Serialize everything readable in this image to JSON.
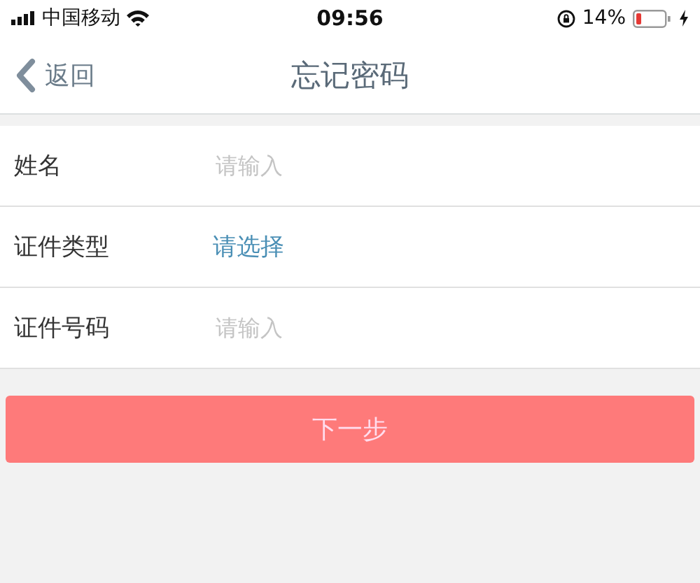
{
  "status_bar": {
    "carrier": "中国移动",
    "time": "09:56",
    "battery": "14%"
  },
  "nav_bar": {
    "back": "返回",
    "title": "忘记密码"
  },
  "form": [
    {
      "kind": "input",
      "label": "姓名",
      "placeholder": "请输入"
    },
    {
      "kind": "select",
      "label": "证件类型",
      "value": "请选择"
    },
    {
      "kind": "input",
      "label": "证件号码",
      "placeholder": "请输入"
    }
  ],
  "next_button": "下一步"
}
